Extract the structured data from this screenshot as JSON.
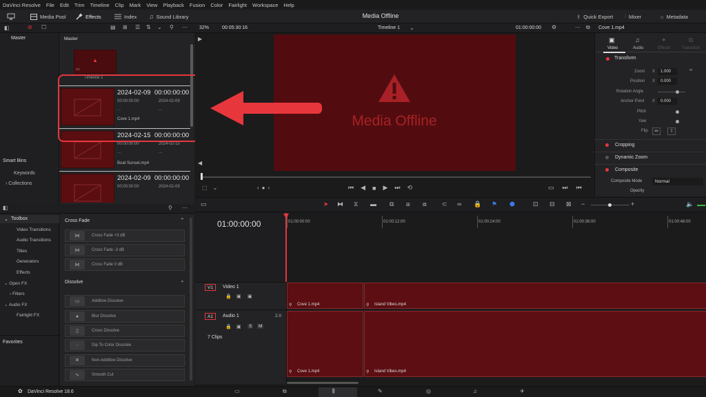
{
  "menu": [
    "DaVinci Resolve",
    "File",
    "Edit",
    "Trim",
    "Timeline",
    "Clip",
    "Mark",
    "View",
    "Playback",
    "Fusion",
    "Color",
    "Fairlight",
    "Workspace",
    "Help"
  ],
  "toolbar": {
    "media_pool": "Media Pool",
    "effects": "Effects",
    "index": "Index",
    "sound_library": "Sound Library",
    "title": "Media Offline",
    "quick_export": "Quick Export",
    "mixer": "Mixer",
    "metadata": "Metadata"
  },
  "subbar": {
    "zoom": "32%",
    "timecode": "00:05:30:16",
    "timeline_name": "Timeline 1",
    "viewer_timecode": "01:00:00:00",
    "clip_name": "Cove 1.mp4"
  },
  "sidebar": {
    "master": "Master",
    "smart_bins": "Smart Bins",
    "keywords": "Keywords",
    "collections": "Collections"
  },
  "pool": {
    "header": "Master",
    "timeline_label": "Timeline 1",
    "clips": [
      {
        "date": "2024-02-09",
        "tc": "00:00:00:00",
        "l1": "00:00:00:00",
        "r1": "2024-02-09",
        "l2": "...",
        "r2": "...",
        "name": "Cove 1.mp4"
      },
      {
        "date": "2024-02-15",
        "tc": "00:00:00:00",
        "l1": "00:00:00:00",
        "r1": "2024-02-15",
        "l2": "...",
        "r2": "...",
        "name": "Boat Sunset.mp4"
      },
      {
        "date": "2024-02-09",
        "tc": "00:00:00:00",
        "l1": "00:00:00:00",
        "r1": "2024-02-09",
        "l2": "",
        "r2": "",
        "name": ""
      }
    ]
  },
  "viewer": {
    "offline_text": "Media Offline"
  },
  "inspector": {
    "tabs": [
      "Video",
      "Audio",
      "Effects",
      "Transition"
    ],
    "transform": "Transform",
    "zoom_label": "Zoom",
    "zoom_x": "1.000",
    "position_label": "Position",
    "position_x": "0.000",
    "rotation_label": "Rotation Angle",
    "anchor_label": "Anchor Point",
    "anchor_x": "0.000",
    "pitch_label": "Pitch",
    "yaw_label": "Yaw",
    "flip_label": "Flip",
    "x": "X",
    "cropping": "Cropping",
    "dynamic_zoom": "Dynamic Zoom",
    "composite": "Composite",
    "composite_mode_label": "Composite Mode",
    "composite_mode_value": "Normal",
    "opacity_label": "Opacity"
  },
  "toolbox": {
    "header": "Toolbox",
    "items": [
      "Video Transitions",
      "Audio Transitions",
      "Titles",
      "Generators",
      "Effects"
    ],
    "open_fx": "Open FX",
    "filters": "Filters",
    "audio_fx": "Audio FX",
    "fairlight_fx": "Fairlight FX",
    "favorites": "Favorites"
  },
  "effects": {
    "cross_fade": "Cross Fade",
    "cross_fade_items": [
      "Cross Fade +3 dB",
      "Cross Fade -3 dB",
      "Cross Fade 0 dB"
    ],
    "dissolve": "Dissolve",
    "dissolve_items": [
      "Additive Dissolve",
      "Blur Dissolve",
      "Cross Dissolve",
      "Dip To Color Dissolve",
      "Non-Additive Dissolve",
      "Smooth Cut"
    ]
  },
  "timeline": {
    "timecode": "01:00:00:00",
    "ruler": [
      "01:00:00:00",
      "01:00:12:00",
      "01:00:24:00",
      "01:00:36:00",
      "01:00:48:00"
    ],
    "v1": "V1",
    "video1": "Video 1",
    "a1": "A1",
    "audio1": "Audio 1",
    "a1_level": "2.0",
    "clips_count": "7 Clips",
    "clip1": "Cove 1.mp4",
    "clip2": "Island Vibes.mp4"
  },
  "footer": {
    "app": "DaVinci Resolve 18.6"
  },
  "colors": {
    "accent_red": "#e8363d",
    "offline_bg": "#5a0e10",
    "clip_bg": "#5c0e12"
  }
}
